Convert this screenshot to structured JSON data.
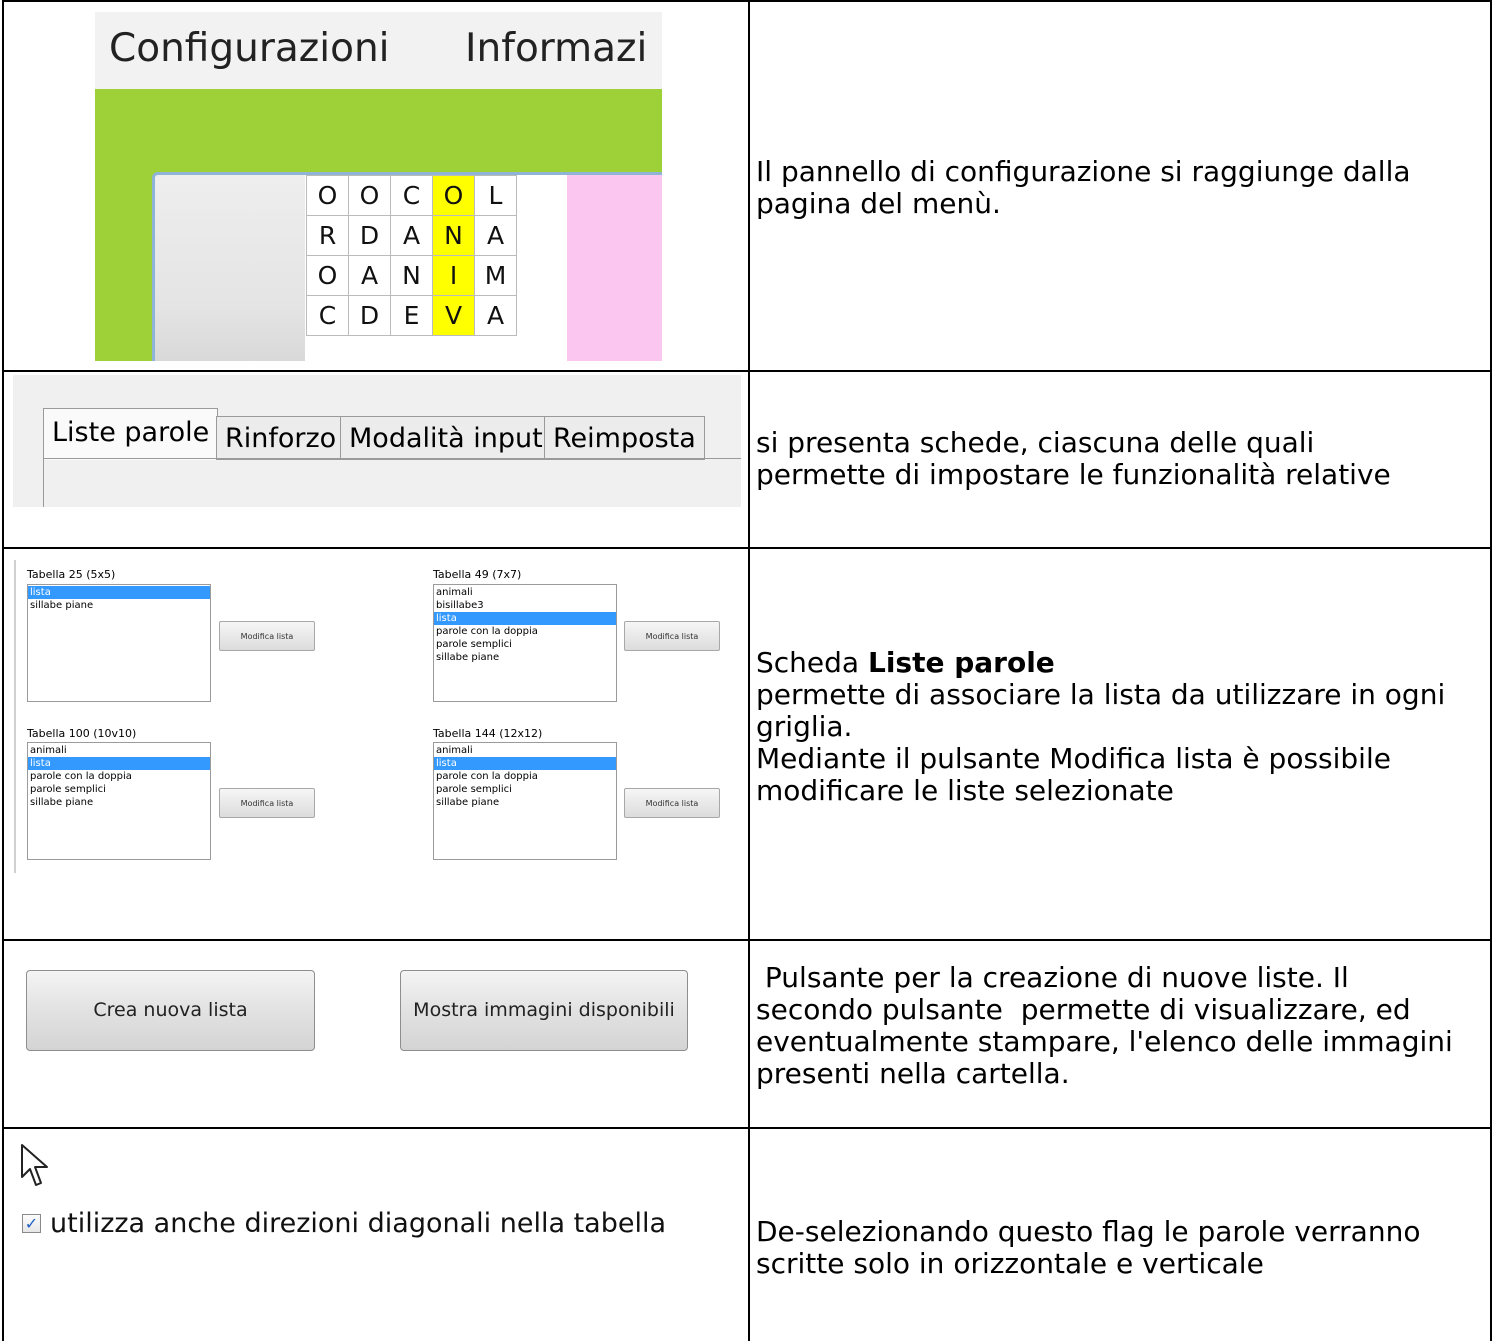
{
  "row1": {
    "menu": [
      "Configurazioni",
      "Informazi"
    ],
    "grid": [
      [
        "O",
        "O",
        "C",
        "O",
        "L"
      ],
      [
        "R",
        "D",
        "A",
        "N",
        "A"
      ],
      [
        "O",
        "A",
        "N",
        "I",
        "M"
      ],
      [
        "C",
        "D",
        "E",
        "V",
        "A"
      ]
    ],
    "highlight_column": 3,
    "description": [
      "Il pannello di configurazione si raggiunge dalla",
      "pagina del menù."
    ]
  },
  "row2": {
    "tabs": [
      "Liste parole",
      "Rinforzo",
      "Modalità input",
      "Reimposta"
    ],
    "active_tab": "Liste parole",
    "description": [
      "si presenta schede, ciascuna delle quali",
      "permette di impostare le funzionalità relative"
    ]
  },
  "row3": {
    "groups": [
      {
        "title": "Tabella 25 (5x5)",
        "items": [
          {
            "label": "lista",
            "selected": true
          },
          {
            "label": "sillabe piane",
            "selected": false
          }
        ],
        "button": "Modifica lista"
      },
      {
        "title": "Tabella 49 (7x7)",
        "items": [
          {
            "label": "animali",
            "selected": false
          },
          {
            "label": "bisillabe3",
            "selected": false
          },
          {
            "label": "lista",
            "selected": true
          },
          {
            "label": "parole con la doppia",
            "selected": false
          },
          {
            "label": "parole semplici",
            "selected": false
          },
          {
            "label": "sillabe piane",
            "selected": false
          }
        ],
        "button": "Modifica lista"
      },
      {
        "title": "Tabella 100 (10v10)",
        "items": [
          {
            "label": "animali",
            "selected": false
          },
          {
            "label": "lista",
            "selected": true
          },
          {
            "label": "parole con la doppia",
            "selected": false
          },
          {
            "label": "parole semplici",
            "selected": false
          },
          {
            "label": "sillabe piane",
            "selected": false
          }
        ],
        "button": "Modifica lista"
      },
      {
        "title": "Tabella 144 (12x12)",
        "items": [
          {
            "label": "animali",
            "selected": false
          },
          {
            "label": "lista",
            "selected": true
          },
          {
            "label": "parole con la doppia",
            "selected": false
          },
          {
            "label": "parole semplici",
            "selected": false
          },
          {
            "label": "sillabe piane",
            "selected": false
          }
        ],
        "button": "Modifica lista"
      }
    ],
    "desc_prefix": "Scheda ",
    "desc_bold": "Liste parole",
    "description": [
      "permette di associare la lista da utilizzare in ogni",
      "griglia.",
      "Mediante il pulsante Modifica lista è possibile",
      "modificare le liste selezionate"
    ]
  },
  "row4": {
    "button_create": "Crea nuova lista",
    "button_images": "Mostra immagini disponibili",
    "description": [
      " Pulsante per la creazione di nuove liste. Il",
      "secondo pulsante  permette di visualizzare, ed",
      "eventualmente stampare, l'elenco delle immagini",
      "presenti nella cartella."
    ]
  },
  "row5": {
    "checkbox_checked": true,
    "checkbox_label": "utilizza anche direzioni diagonali nella tabella",
    "description": [
      "De-selezionando questo flag le parole verranno",
      "scritte solo in orizzontale e verticale"
    ]
  }
}
